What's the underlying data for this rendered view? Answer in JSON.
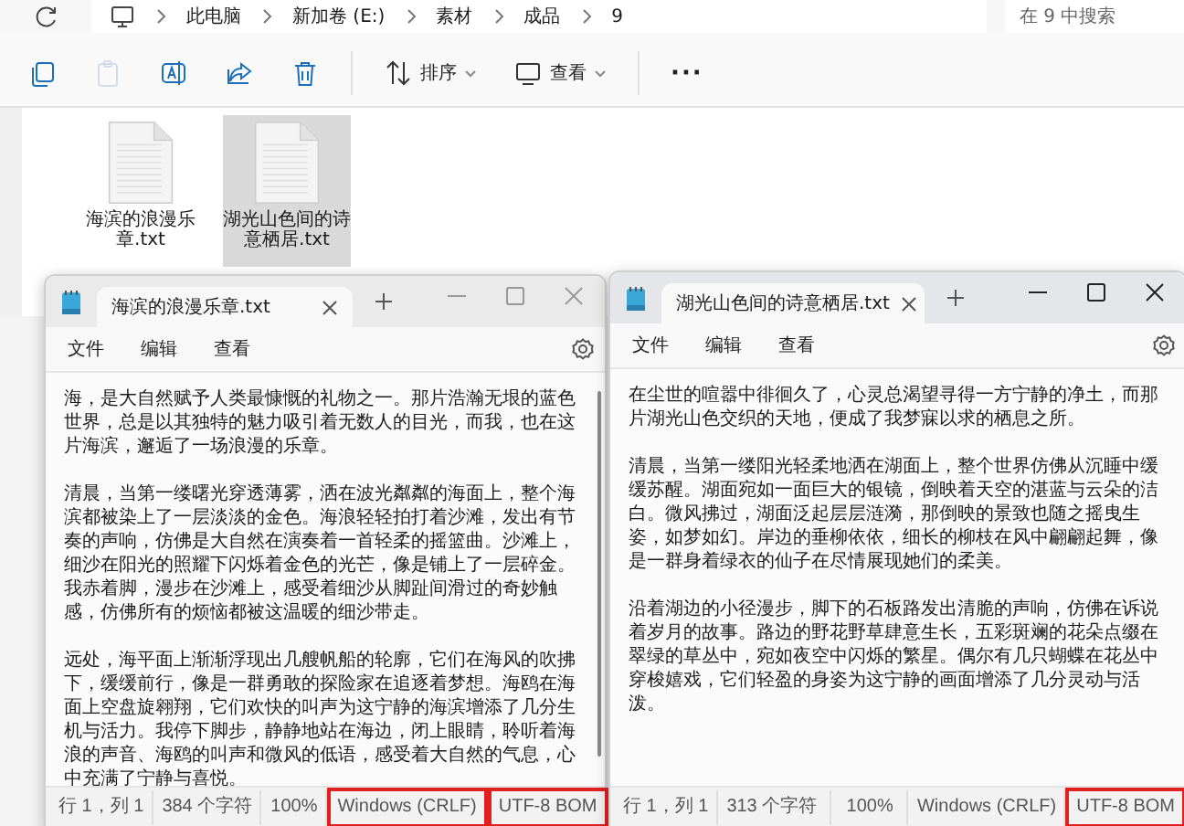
{
  "explorer": {
    "address": [
      "此电脑",
      "新加卷 (E:)",
      "素材",
      "成品",
      "9"
    ],
    "search": {
      "placeholder": "在 9 中搜索"
    },
    "toolbar": [
      {
        "kind": "icon",
        "disabled": false
      },
      {
        "kind": "icon",
        "disabled": true
      },
      {
        "kind": "icon",
        "disabled": false
      },
      {
        "kind": "icon",
        "disabled": false
      },
      {
        "kind": "icon",
        "disabled": false
      },
      {
        "kind": "menu",
        "label": "排序",
        "disabled": false
      },
      {
        "kind": "menu",
        "label": "查看",
        "disabled": false
      },
      {
        "kind": "more",
        "label": "···"
      }
    ],
    "files": [
      {
        "name": "海滨的浪漫乐章.txt",
        "selected": false
      },
      {
        "name": "湖光山色间的诗意栖居.txt",
        "selected": true
      }
    ]
  },
  "notepads": [
    {
      "tab": "海滨的浪漫乐章.txt",
      "active": false,
      "menu": [
        "文件",
        "编辑",
        "查看"
      ],
      "paragraphs": [
        "海，是大自然赋予人类最慷慨的礼物之一。那片浩瀚无垠的蓝色世界，总是以其独特的魅力吸引着无数人的目光，而我，也在这片海滨，邂逅了一场浪漫的乐章。",
        "清晨，当第一缕曙光穿透薄雾，洒在波光粼粼的海面上，整个海滨都被染上了一层淡淡的金色。海浪轻轻拍打着沙滩，发出有节奏的声响，仿佛是大自然在演奏着一首轻柔的摇篮曲。沙滩上，细沙在阳光的照耀下闪烁着金色的光芒，像是铺上了一层碎金。我赤着脚，漫步在沙滩上，感受着细沙从脚趾间滑过的奇妙触感，仿佛所有的烦恼都被这温暖的细沙带走。",
        "远处，海平面上渐渐浮现出几艘帆船的轮廓，它们在海风的吹拂下，缓缓前行，像是一群勇敢的探险家在追逐着梦想。海鸥在海面上空盘旋翱翔，它们欢快的叫声为这宁静的海滨增添了几分生机与活力。我停下脚步，静静地站在海边，闭上眼睛，聆听着海浪的声音、海鸥的叫声和微风的低语，感受着大自然的气息，心中充满了宁静与喜悦。"
      ],
      "status": [
        {
          "text": "行 1，列 1",
          "highlighted": false
        },
        {
          "text": "384 个字符",
          "highlighted": false
        },
        {
          "text": "100%",
          "highlighted": false
        },
        {
          "text": "Windows (CRLF)",
          "highlighted": true
        },
        {
          "text": "UTF-8 BOM",
          "highlighted": true
        }
      ]
    },
    {
      "tab": "湖光山色间的诗意栖居.txt",
      "active": true,
      "menu": [
        "文件",
        "编辑",
        "查看"
      ],
      "paragraphs": [
        "在尘世的喧嚣中徘徊久了，心灵总渴望寻得一方宁静的净土，而那片湖光山色交织的天地，便成了我梦寐以求的栖息之所。",
        "清晨，当第一缕阳光轻柔地洒在湖面上，整个世界仿佛从沉睡中缓缓苏醒。湖面宛如一面巨大的银镜，倒映着天空的湛蓝与云朵的洁白。微风拂过，湖面泛起层层涟漪，那倒映的景致也随之摇曳生姿，如梦如幻。岸边的垂柳依依，细长的柳枝在风中翩翩起舞，像是一群身着绿衣的仙子在尽情展现她们的柔美。",
        "沿着湖边的小径漫步，脚下的石板路发出清脆的声响，仿佛在诉说着岁月的故事。路边的野花野草肆意生长，五彩斑斓的花朵点缀在翠绿的草丛中，宛如夜空中闪烁的繁星。偶尔有几只蝴蝶在花丛中穿梭嬉戏，它们轻盈的身姿为这宁静的画面增添了几分灵动与活泼。"
      ],
      "status": [
        {
          "text": "行 1，列 1",
          "highlighted": false
        },
        {
          "text": "313 个字符",
          "highlighted": false
        },
        {
          "text": "100%",
          "highlighted": false
        },
        {
          "text": "Windows (CRLF)",
          "highlighted": false
        },
        {
          "text": "UTF-8 BOM",
          "highlighted": true
        }
      ]
    }
  ]
}
